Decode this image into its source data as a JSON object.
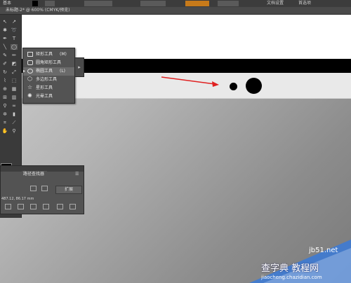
{
  "document": {
    "tab_title": "未标题-2* @ 600% (CMYK/预览)"
  },
  "topbar": {
    "left_label": "基本",
    "right_label_1": "文档设置",
    "right_label_2": "首选项"
  },
  "shape_flyout": {
    "items": [
      {
        "label": "矩形工具",
        "shortcut": "(M)"
      },
      {
        "label": "圆角矩形工具",
        "shortcut": ""
      },
      {
        "label": "椭圆工具",
        "shortcut": "(L)"
      },
      {
        "label": "多边形工具",
        "shortcut": ""
      },
      {
        "label": "星形工具",
        "shortcut": ""
      },
      {
        "label": "光晕工具",
        "shortcut": ""
      }
    ],
    "selected_index": 2
  },
  "panel": {
    "tab_label": "路径查找器",
    "menu_icon": "panel-menu-icon",
    "expand_label": "扩展",
    "coord_text": "487.12, 86.17 mm"
  },
  "watermark": {
    "line1": "jb51.net",
    "line2": "查字典 教程网",
    "line3": "jiaocheng.chazidian.com"
  },
  "colors": {
    "annotation_arrow": "#e02020",
    "canvas_black": "#000000"
  }
}
